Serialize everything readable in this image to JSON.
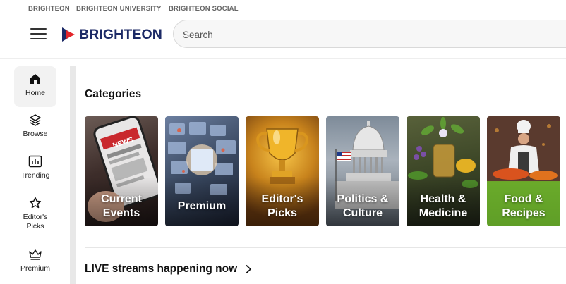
{
  "topbar": {
    "links": [
      "BRIGHTEON",
      "BRIGHTEON UNIVERSITY",
      "BRIGHTEON SOCIAL"
    ]
  },
  "header": {
    "logo_text": "BRIGHTEON",
    "search_placeholder": "Search"
  },
  "sidebar": {
    "items": [
      {
        "label": "Home",
        "icon": "home-icon"
      },
      {
        "label": "Browse",
        "icon": "layers-icon"
      },
      {
        "label": "Trending",
        "icon": "chart-icon"
      },
      {
        "label": "Editor's Picks",
        "icon": "star-icon"
      },
      {
        "label": "Premium",
        "icon": "crown-icon"
      }
    ]
  },
  "main": {
    "categories_title": "Categories",
    "categories": [
      {
        "label": "Current Events"
      },
      {
        "label": "Premium"
      },
      {
        "label": "Editor's Picks"
      },
      {
        "label": "Politics & Culture"
      },
      {
        "label": "Health & Medicine"
      },
      {
        "label": "Food & Recipes"
      }
    ],
    "live_title": "LIVE streams happening now"
  },
  "colors": {
    "brand": "#1c2a66",
    "accent": "#e3262b",
    "food_green": "#6aaa2a"
  }
}
